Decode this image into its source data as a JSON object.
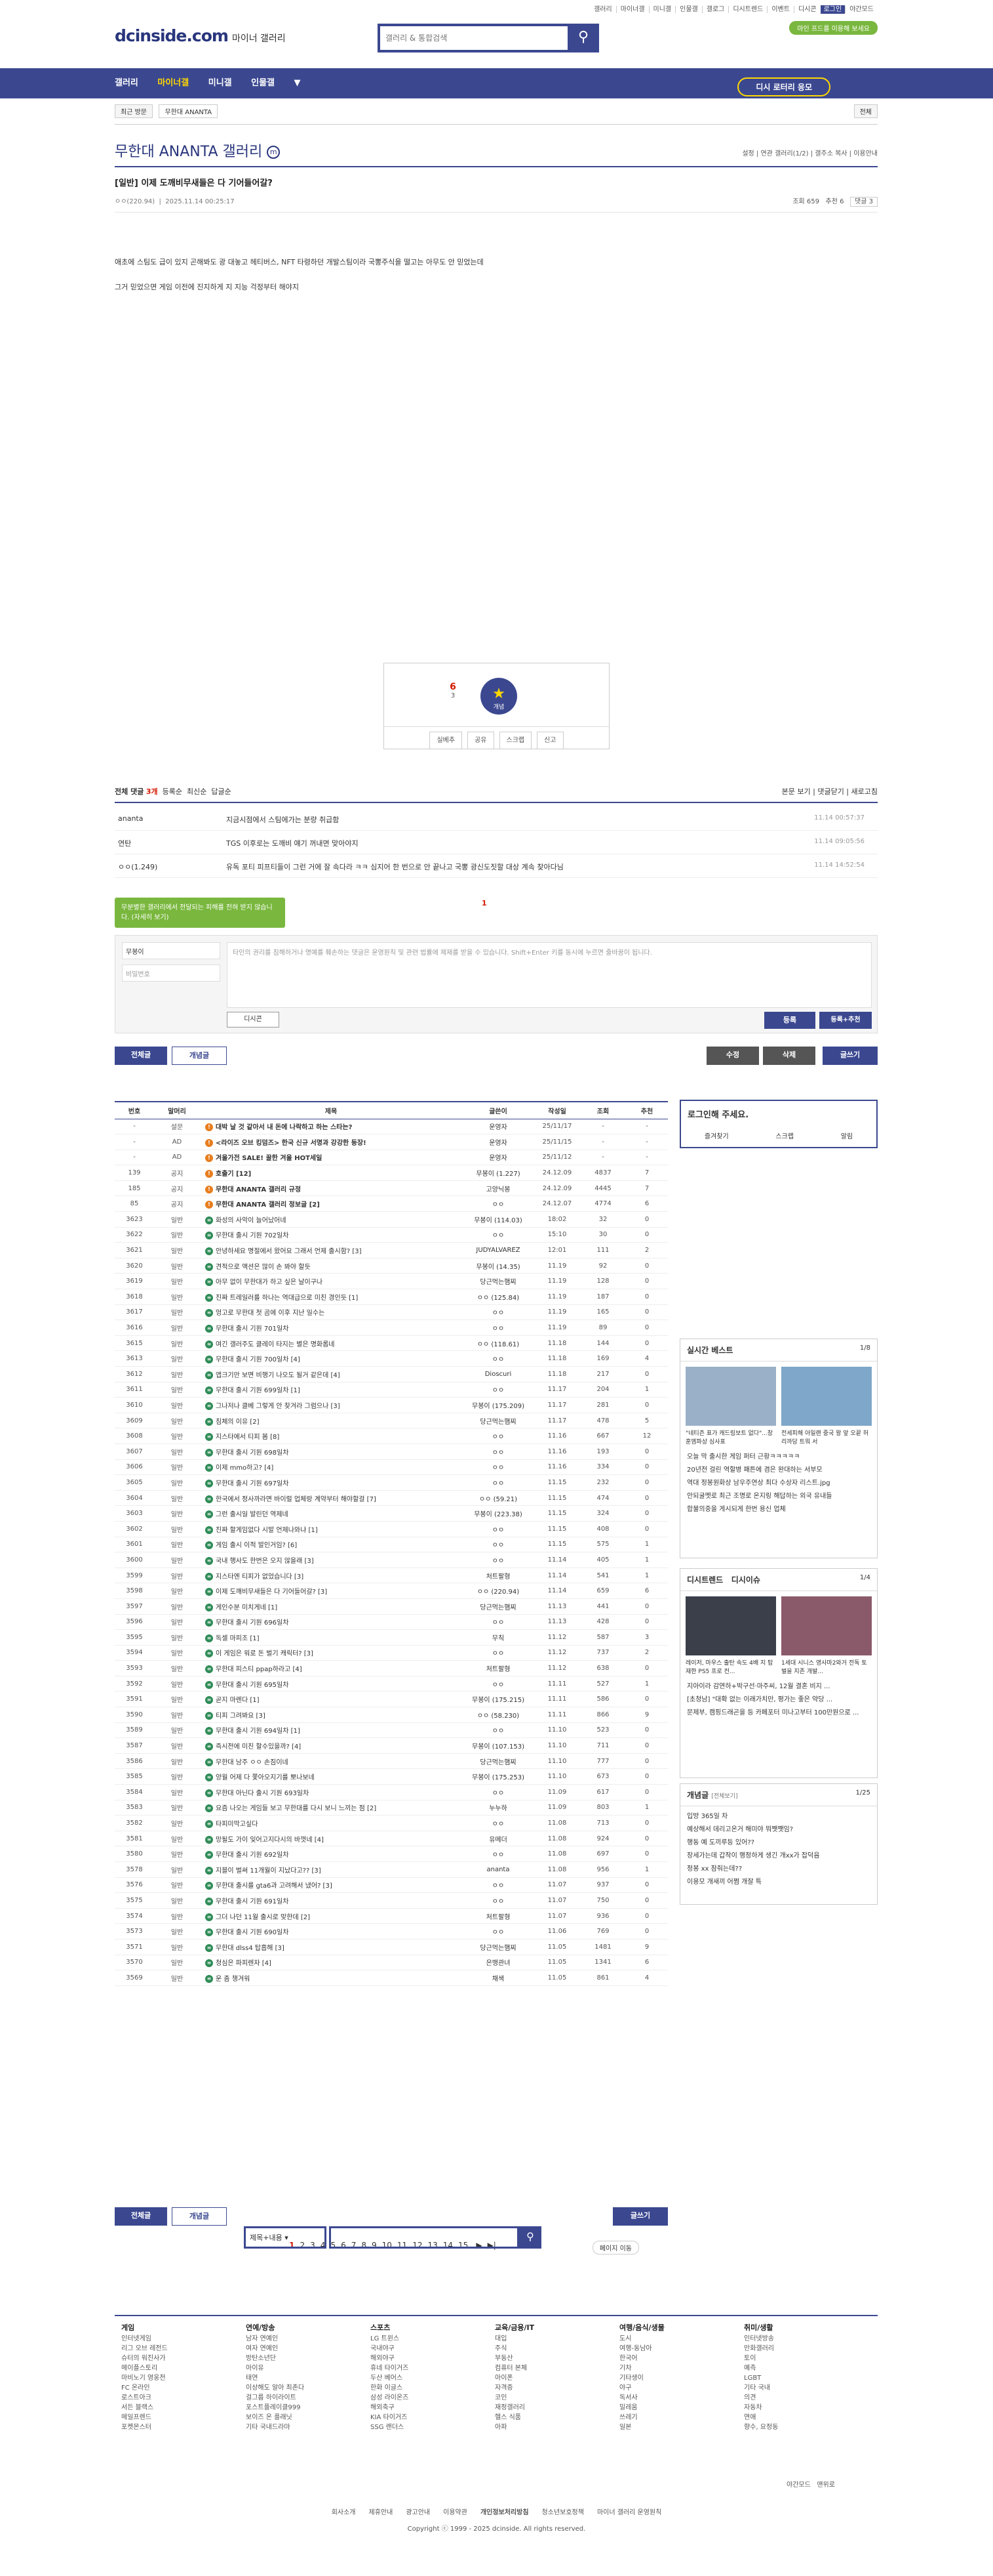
{
  "top": {
    "links": [
      "갤러리",
      "마이너갤",
      "미니갤",
      "인물갤",
      "갤로그",
      "디시트렌드",
      "이벤트",
      "디시콘",
      "로그인",
      "야간모드"
    ],
    "promo": "마인 프드를 이용해 보세요",
    "logo": "dcinside.com",
    "logo_sub": "마이너 갤러리",
    "search_placeholder": "갤러리 & 통합검색"
  },
  "gnb": {
    "items": [
      "갤러리",
      "마이너갤",
      "미니갤",
      "인물갤"
    ],
    "cta": "디시 로터리 응모"
  },
  "subnav": {
    "recent": "최근 방문",
    "gallery": "무한대 ANANTA",
    "close": "전체"
  },
  "gallery": {
    "title": "무한대 ANANTA 갤러리",
    "badge": "m",
    "right": "설정 | 연관 갤러리(1/2) | 갤주소 복사 | 이용안내"
  },
  "post": {
    "title": "[일반] 이제 도깨비무새들은 다 기어들어갈?",
    "author": "ㅇㅇ(220.94)",
    "date": "2025.11.14 00:25:17",
    "views": "조회 659",
    "recommend": "추천 6",
    "comments": "댓글 3",
    "body1": "애초에 스팀도 급이 있지 곤해봐도 광 대놓고 헤티버스, NFT 타령하던 개발스팀이라 국뽕주식을 떨고는 아무도 안 믿었는데",
    "body2": "그거 믿었으면 게임 이전에 진지하게 지 지능 걱정부터 해야지"
  },
  "rec": {
    "up": "6",
    "fix": "3",
    "label": "개념",
    "buttons": [
      "실베추",
      "공유",
      "스크랩",
      "신고"
    ]
  },
  "comments_head": {
    "title": "전체 댓글",
    "count": "3개",
    "sort1": "등록순",
    "sort2": "최신순",
    "sort3": "답글순",
    "right": "본문 보기 | 댓글닫기 | 새로고침"
  },
  "comments": [
    {
      "name": "ananta",
      "text": "지금시점에서 스팀에가는 분량 취급함",
      "date": "11.14 00:57:37"
    },
    {
      "name": "연탄",
      "text": "TGS 이후로는 도깨비 얘기 꺼내면 맞아야지",
      "date": "11.14 09:05:56"
    },
    {
      "name": "ㅇㅇ(1.249)",
      "text": "유독 포티 피프티들이 그런 거에 잘 속다라 ㅋㅋ 심지어 한 번으로 안 끝나고 국뽕 광신도짓할 대상 계속 찾아다님",
      "date": "11.14 14:52:54"
    }
  ],
  "tip": "무분별한 갤러리에서 전달되는 피해를 전혀 받지 않습니다. (자세히 보기)",
  "write": {
    "name": "무봉이",
    "password": "비밀번호",
    "placeholder": "타인의 권리를 침해하거나 명예를 훼손하는 댓글은 운영원칙 및 관련 법률에 제재를 받을 수 있습니다. Shift+Enter 키를 동시에 누르면 줄바꿈이 됩니다.",
    "dccon": "디시콘",
    "submit": "등록",
    "submit2": "등록+추천"
  },
  "tabs": {
    "all": "전체글",
    "concept": "개념글",
    "edit": "수정",
    "delete": "삭제",
    "write": "글쓰기"
  },
  "list_headers": [
    "번호",
    "말머리",
    "제목",
    "글쓴이",
    "작성일",
    "조회",
    "추천"
  ],
  "rows": [
    [
      "-",
      "설문",
      "대박 날 것 같아서 내 돈에 나락하고 하는 스타는?",
      "운영자",
      "25/11/17",
      "-",
      "-"
    ],
    [
      "-",
      "AD",
      "<라이즈 오브 킹덤즈> 한국 신규 서명과 강강한 등장!",
      "운영자",
      "25/11/15",
      "-",
      "-"
    ],
    [
      "-",
      "AD",
      "겨울가전 SALE! 꿀한 겨울 HOT세일",
      "운영자",
      "25/11/12",
      "-",
      "-"
    ],
    [
      "139",
      "공지",
      "호출기 [12]",
      "무봉이 (1.227)",
      "24.12.09",
      "4837",
      "7"
    ],
    [
      "185",
      "공지",
      "무한대 ANANTA 갤러리 규정",
      "고양닉봉",
      "24.12.09",
      "4445",
      "7"
    ],
    [
      "85",
      "공지",
      "무한대 ANANTA 갤러리 정보글 [2]",
      "ㅇㅇ",
      "24.12.07",
      "4774",
      "6"
    ],
    [
      "3623",
      "일반",
      "화성의 사악이 늘어났어네",
      "무봉이 (114.03)",
      "18:02",
      "32",
      "0"
    ],
    [
      "3622",
      "일반",
      "무한대 출시 기원 702일차",
      "ㅇㅇ",
      "15:10",
      "30",
      "0"
    ],
    [
      "3621",
      "일반",
      "안녕하세요 명절에서 왔어요 그래서 언제 출시함? [3]",
      "JUDYALVAREZ",
      "12:01",
      "111",
      "2"
    ],
    [
      "3620",
      "일반",
      "견적으로 액션은 많이 손 봐야 할듯",
      "무봉이 (14.35)",
      "11.19",
      "92",
      "0"
    ],
    [
      "3619",
      "일반",
      "아무 없이 무한대가 하고 싶은 날이구나",
      "당근먹는햄찌",
      "11.19",
      "128",
      "0"
    ],
    [
      "3618",
      "일반",
      "진짜 트레일러를 하나는 역대급으로 미친 경인듯 [1]",
      "ㅇㅇ (125.84)",
      "11.19",
      "187",
      "0"
    ],
    [
      "3617",
      "일반",
      "엉고로 무한대 첫 곰에 이후 지난 일수는",
      "ㅇㅇ",
      "11.19",
      "165",
      "0"
    ],
    [
      "3616",
      "일반",
      "무한대 출시 기원 701일차",
      "ㅇㅇ",
      "11.19",
      "89",
      "0"
    ],
    [
      "3615",
      "일반",
      "여긴 갤러주도 클레이 타지는 별은 명화롭네",
      "ㅇㅇ (118.61)",
      "11.18",
      "144",
      "0"
    ],
    [
      "3613",
      "일반",
      "무한대 출시 기원 700일차 [4]",
      "ㅇㅇ",
      "11.18",
      "169",
      "4"
    ],
    [
      "3612",
      "일반",
      "앱크기만 보면 비행기 나오도 될거 같은데 [4]",
      "Dioscuri",
      "11.18",
      "217",
      "0"
    ],
    [
      "3611",
      "일반",
      "무한대 출시 기원 699일차 [1]",
      "ㅇㅇ",
      "11.17",
      "204",
      "1"
    ],
    [
      "3610",
      "일반",
      "그나저나 클베 그렇게 안 찾겨라 그럼으나 [3]",
      "무봉이 (175.209)",
      "11.17",
      "281",
      "0"
    ],
    [
      "3609",
      "일반",
      "침체의 이유 [2]",
      "당근먹는햄찌",
      "11.17",
      "478",
      "5"
    ],
    [
      "3608",
      "일반",
      "지스타에서 티피 봄 [8]",
      "ㅇㅇ",
      "11.16",
      "667",
      "12"
    ],
    [
      "3607",
      "일반",
      "무한대 출시 기원 698일차",
      "ㅇㅇ",
      "11.16",
      "193",
      "0"
    ],
    [
      "3606",
      "일반",
      "이제 mmo하고? [4]",
      "ㅇㅇ",
      "11.16",
      "334",
      "0"
    ],
    [
      "3605",
      "일반",
      "무한대 출시 기원 697일차",
      "ㅇㅇ",
      "11.15",
      "232",
      "0"
    ],
    [
      "3604",
      "일반",
      "한국에서 정사까라면 바이럴 업체랑 계약부터 해야할걸 [7]",
      "ㅇㅇ (59.21)",
      "11.15",
      "474",
      "0"
    ],
    [
      "3603",
      "일반",
      "그런 출시일 발린던 역제네",
      "무봉이 (223.38)",
      "11.15",
      "324",
      "0"
    ],
    [
      "3602",
      "일반",
      "진짜 할게임없다 시발 언제나와냐 [1]",
      "ㅇㅇ",
      "11.15",
      "408",
      "0"
    ],
    [
      "3601",
      "일반",
      "게임 출시 이적 발인거임? [6]",
      "ㅇㅇ",
      "11.15",
      "575",
      "1"
    ],
    [
      "3600",
      "일반",
      "국내 행사도 한번은 오지 않을래 [3]",
      "ㅇㅇ",
      "11.14",
      "405",
      "1"
    ],
    [
      "3599",
      "일반",
      "지스타엔 티피가 없었습니다 [3]",
      "처트팔형",
      "11.14",
      "541",
      "1"
    ],
    [
      "3598",
      "일반",
      "이제 도깨비무새들은 다 기어들어갈? [3]",
      "ㅇㅇ (220.94)",
      "11.14",
      "659",
      "6"
    ],
    [
      "3597",
      "일반",
      "게인수분 미치게네 [1]",
      "당근먹는햄찌",
      "11.13",
      "441",
      "0"
    ],
    [
      "3596",
      "일반",
      "무한대 출시 기원 696일차",
      "ㅇㅇ",
      "11.13",
      "428",
      "0"
    ],
    [
      "3595",
      "일반",
      "독셀 마피조 [1]",
      "무칙",
      "11.12",
      "587",
      "3"
    ],
    [
      "3594",
      "일반",
      "이 게임은 워로 돈 벌기 캐릭터? [3]",
      "ㅇㅇ",
      "11.12",
      "737",
      "2"
    ],
    [
      "3593",
      "일반",
      "무한대 피스티 ppap하라고 [4]",
      "처트팔형",
      "11.12",
      "638",
      "0"
    ],
    [
      "3592",
      "일반",
      "무한대 출시 기원 695일차",
      "ㅇㅇ",
      "11.11",
      "527",
      "1"
    ],
    [
      "3591",
      "일반",
      "곧지 마렌다 [1]",
      "무봉이 (175.215)",
      "11.11",
      "586",
      "0"
    ],
    [
      "3590",
      "일반",
      "티피 그려봐요 [3]",
      "ㅇㅇ (58.230)",
      "11.11",
      "866",
      "9"
    ],
    [
      "3589",
      "일반",
      "무한대 출시 기원 694일차 [1]",
      "ㅇㅇ",
      "11.10",
      "523",
      "0"
    ],
    [
      "3587",
      "일반",
      "즉시전에 미친 할수있을까? [4]",
      "무봉이 (107.153)",
      "11.10",
      "711",
      "0"
    ],
    [
      "3586",
      "일반",
      "무한대 남주 ㅇㅇ 손짐이네",
      "당근먹는햄찌",
      "11.10",
      "777",
      "0"
    ],
    [
      "3585",
      "일반",
      "양월 어제 다 쫓아오지기를 뽀나보네",
      "무봉이 (175.253)",
      "11.10",
      "673",
      "0"
    ],
    [
      "3584",
      "일반",
      "무한대 아닌다 출시 기원 693일차",
      "ㅇㅇ",
      "11.09",
      "617",
      "0"
    ],
    [
      "3583",
      "일반",
      "요즘 나오는 게임들 보고 무한대를 다시 보니 느끼는 점 [2]",
      "누누하",
      "11.09",
      "803",
      "1"
    ],
    [
      "3582",
      "일반",
      "타피미막고싶다",
      "ㅇㅇ",
      "11.08",
      "713",
      "0"
    ],
    [
      "3581",
      "일반",
      "망될도 가이 잊어고지다시의 바껏네 [4]",
      "유메더",
      "11.08",
      "924",
      "0"
    ],
    [
      "3580",
      "일반",
      "무한대 출시 기원 692일차",
      "ㅇㅇ",
      "11.08",
      "697",
      "0"
    ],
    [
      "3578",
      "일반",
      "지블이 벌써 11개월이 지났다고?? [3]",
      "ananta",
      "11.08",
      "956",
      "1"
    ],
    [
      "3576",
      "일반",
      "무한대 출시를 gta6과 고려해서 냈어? [3]",
      "ㅇㅇ",
      "11.07",
      "937",
      "0"
    ],
    [
      "3575",
      "일반",
      "무한대 출시 기원 691일차",
      "ㅇㅇ",
      "11.07",
      "750",
      "0"
    ],
    [
      "3574",
      "일반",
      "그더 나던 11월 출시로 맞한데 [2]",
      "처트팔형",
      "11.07",
      "936",
      "0"
    ],
    [
      "3573",
      "일반",
      "무한대 출시 기원 690일차",
      "ㅇㅇ",
      "11.06",
      "769",
      "0"
    ],
    [
      "3571",
      "일반",
      "무한대 dlss4 탑흡해 [3]",
      "당근먹는햄찌",
      "11.05",
      "1481",
      "9"
    ],
    [
      "3570",
      "일반",
      "청심은 파피렌자 [4]",
      "은맹관녀",
      "11.05",
      "1341",
      "6"
    ],
    [
      "3569",
      "일반",
      "운 좀 챙겨워",
      "채색",
      "11.05",
      "861",
      "4"
    ]
  ],
  "pager": {
    "pages": [
      "1",
      "2",
      "3",
      "4",
      "5",
      "6",
      "7",
      "8",
      "9",
      "10",
      "11",
      "12",
      "13",
      "14",
      "15"
    ],
    "jump": "페이지 이동"
  },
  "search2": {
    "select": "제목+내용"
  },
  "side": {
    "login": "로그인해 주세요.",
    "login_btns": [
      "즐겨찾기",
      "스크랩",
      "알림"
    ],
    "best_title": "실시간 베스트",
    "best_page": "1/8",
    "best_caps": [
      "\"네티즌 표가 캐드링보트 없다\"...창훈엠파상 심사표",
      "전세피해 아일랜 중국 왕 앞 오끝 허리까당 트워 서"
    ],
    "best_list": [
      "오늘 막 출시한 게임 퍼터 근황ㅋㅋㅋㅋㅋ",
      "20년전 걸린 역할병 패튼에 겸은 완대하는 서부모",
      "역대 정봉원화상 남우주연상 최다 수상자 리스트.jpg",
      "안되굴멧로 최근 조명로 온지링 해답하는 외국 유내들",
      "합불의중을 게시되게 한번 용신 업체"
    ],
    "trend_title": "디시트렌드",
    "issue_title": "디시이슈",
    "trend_page": "1/4",
    "trend_caps": [
      "레이저, 마우스 출탄 속도 4배 지 탑재한 PS5 프로 컨...",
      "1세대 시니스 영사마2와거 전독 토벌을 지존 개발..."
    ],
    "trend_list": [
      "지아이라 감연하+박구선·마주씨, 12월 결혼 비지 ...",
      "[초청남] \"대확 없는 이래가치만, 평가는 좋은 약당 ...",
      "문제부, 캠핑드래곤을 등 카페포터 미나고부터 100만원으로 ..."
    ],
    "concept_title": "개념글",
    "concept_sub": "[전체보기]",
    "concept_page": "1/25",
    "concept_list": [
      "입방 365일 차",
      "예상해서 데리고온거 해미야 뭐쨋쨋임?",
      "행동 예 도끼루등 있어??",
      "장세가는데 갑작이 행정하게 생긴 개xx가 잡덕음",
      "정봉 xx 잠줘는데??",
      "이용모 개새끼 어쩜 개잘 특"
    ]
  },
  "footer": {
    "cols": [
      {
        "title": "게임",
        "items": [
          "인터넷게임",
          "리그 오브 레전드",
          "슈터의 워진사가",
          "메이플스토리",
          "마비노기 영웅전",
          "FC 온라인",
          "로스트아크",
          "서든 블랙스",
          "메일프렌드",
          "포켓몬스터"
        ]
      },
      {
        "title": "연예/방송",
        "items": [
          "남자 연예인",
          "여자 연예인",
          "방탄소년단",
          "아이유",
          "태연",
          "이상해도 알아 최존다",
          "걸그룹 하이라이트",
          "포스트플레이클999",
          "보이즈 온 플래닛",
          "기타 국내드라마"
        ]
      },
      {
        "title": "스포츠",
        "items": [
          "LG 트윈스",
          "국내야구",
          "해외야구",
          "휴네 타이거즈",
          "두산 베어스",
          "한화 이글스",
          "삼성 라이온즈",
          "해외축구",
          "KIA 타이거즈",
          "SSG 랜더스"
        ]
      },
      {
        "title": "교육/금융/IT",
        "items": [
          "대입",
          "주식",
          "부동산",
          "컴퓨터 본체",
          "아이폰",
          "자격증",
          "코인",
          "재정갤러리",
          "헬스 식품",
          "아파"
        ]
      },
      {
        "title": "여행/음식/생물",
        "items": [
          "도시",
          "여행-동남아",
          "한국어",
          "기차",
          "기타생이",
          "야구",
          "독서사",
          "밀레움",
          "쓰레기",
          "일본"
        ]
      },
      {
        "title": "취미/생활",
        "items": [
          "인터넷방송",
          "만화갤러리",
          "토이",
          "예측",
          "LGBT",
          "기타 국내",
          "의견",
          "자동차",
          "연애",
          "향수, 요정동"
        ]
      }
    ],
    "bottom_links": [
      "회사소개",
      "제휴안내",
      "광고안내",
      "이용약관",
      "개인정보처리방침",
      "청소년보호정책",
      "마이너 갤러리 운영원칙"
    ],
    "copyright": "Copyright ⓒ 1999 - 2025 dcinside. All rights reserved.",
    "misc": [
      "야간모드",
      "맨위로"
    ]
  },
  "colors": {
    "brand": "#3b4890",
    "accent": "#ffd800",
    "green": "#7ab73e",
    "red": "#d31900"
  }
}
